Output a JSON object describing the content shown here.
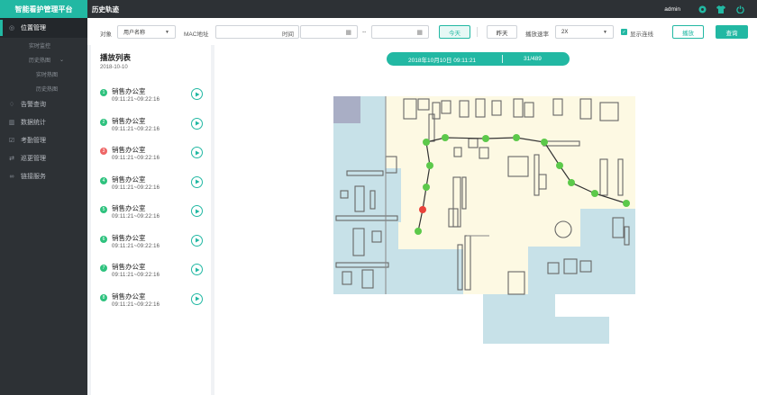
{
  "app": {
    "brand": "智能看护管理平台",
    "page_title": "历史轨迹",
    "user": "admin"
  },
  "sidebar": {
    "items": [
      {
        "label": "位置管理",
        "icon": "location-icon",
        "active": true
      },
      {
        "label": "实时监控",
        "level": 2
      },
      {
        "label": "历史热图",
        "level": 2
      },
      {
        "label": "实时热图",
        "level": 3
      },
      {
        "label": "历史热图",
        "level": 3
      },
      {
        "label": "告警查询",
        "icon": "bell-icon"
      },
      {
        "label": "数据统计",
        "icon": "chart-icon"
      },
      {
        "label": "考勤管理",
        "icon": "calendar-icon"
      },
      {
        "label": "巡更管理",
        "icon": "patrol-icon"
      },
      {
        "label": "链接服务",
        "icon": "link-icon"
      }
    ]
  },
  "filters": {
    "object_label": "对象",
    "object_value": "用户名称",
    "mac_label": "MAC地址",
    "mac_value": "",
    "time_label": "时间",
    "time_sep": "--",
    "start_value": "",
    "end_value": "",
    "today_label": "今天",
    "yesterday_label": "昨天",
    "speed_label": "播放速率",
    "speed_value": "2X",
    "show_line_label": "显示连线",
    "play_label": "播放",
    "query_label": "查询"
  },
  "playlist": {
    "title": "播放列表",
    "date": "2018-10-10",
    "items": [
      {
        "num": "1",
        "name": "销售办公室",
        "time": "09:11:21~09:22:16",
        "status": "green"
      },
      {
        "num": "2",
        "name": "销售办公室",
        "time": "09:11:21~09:22:16",
        "status": "green"
      },
      {
        "num": "3",
        "name": "销售办公室",
        "time": "09:11:21~09:22:16",
        "status": "red"
      },
      {
        "num": "4",
        "name": "销售办公室",
        "time": "09:11:21~09:22:16",
        "status": "green"
      },
      {
        "num": "5",
        "name": "销售办公室",
        "time": "09:11:21~09:22:16",
        "status": "green"
      },
      {
        "num": "6",
        "name": "销售办公室",
        "time": "09:11:21~09:22:16",
        "status": "green"
      },
      {
        "num": "7",
        "name": "销售办公室",
        "time": "09:11:21~09:22:16",
        "status": "green"
      },
      {
        "num": "8",
        "name": "销售办公室",
        "time": "09:11:21~09:22:16",
        "status": "green"
      }
    ]
  },
  "status": {
    "timestamp": "2018年10月10日  09:11:21",
    "counter": "31/489"
  },
  "colors": {
    "accent": "#22b8a3",
    "sidebar": "#2d3135",
    "room_blue": "#c7e1e8",
    "room_yellow": "#fdf9e3",
    "point_green": "#5cc94a",
    "point_red": "#e9423a"
  }
}
